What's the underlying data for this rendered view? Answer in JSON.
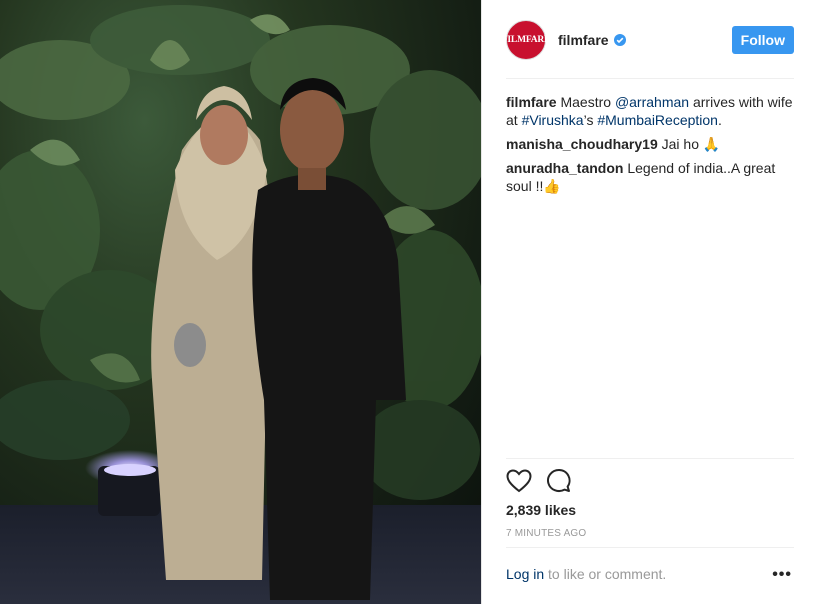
{
  "post": {
    "account": "filmfare",
    "avatar_text": "FILMFARE",
    "follow_label": "Follow",
    "caption_user": "filmfare",
    "caption_parts": {
      "t1": "Maestro ",
      "mention": "@arrahman",
      "t2": " arrives with wife at ",
      "tag1": "#Virushka",
      "t3": "’s ",
      "tag2": "#MumbaiReception",
      "t4": "."
    },
    "comments": [
      {
        "user": "manisha_choudhary19",
        "text": "Jai ho 🙏"
      },
      {
        "user": "anuradha_tandon",
        "text": "Legend of india..A great soul !!👍"
      }
    ],
    "likes": "2,839 likes",
    "time": "7 MINUTES AGO",
    "login_link": "Log in",
    "login_rest": " to like or comment.",
    "more": "•••"
  },
  "icons": {
    "like": "heart-icon",
    "comment": "comment-bubble-icon",
    "verified": "verified-badge-icon",
    "more": "more-options-icon"
  },
  "colors": {
    "follow_button": "#3897f0",
    "link": "#003569",
    "avatar_bg": "#c8102e",
    "muted": "#999999"
  }
}
